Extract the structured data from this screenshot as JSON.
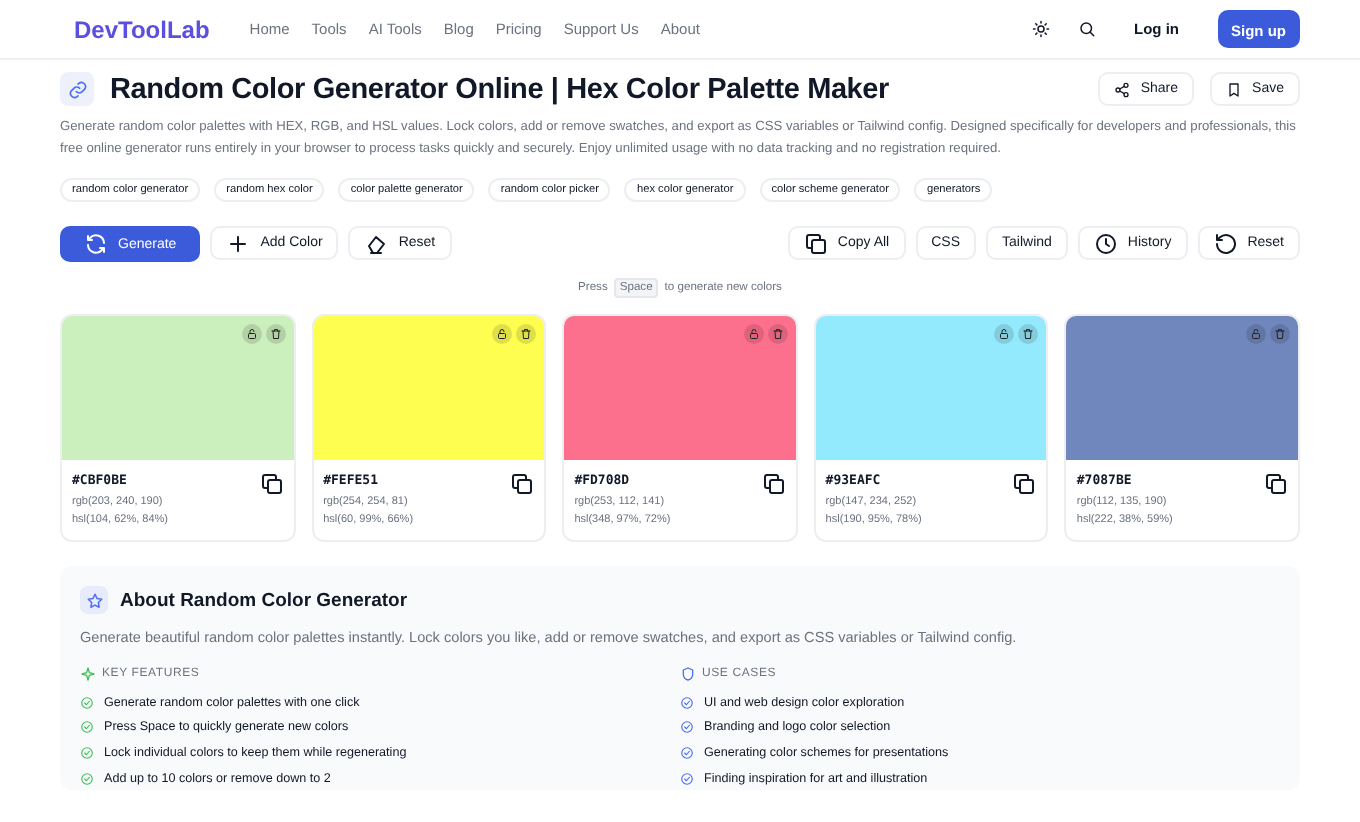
{
  "nav": {
    "logo": "DevToolLab",
    "links": [
      "Home",
      "Tools",
      "AI Tools",
      "Blog",
      "Pricing",
      "Support Us",
      "About"
    ],
    "login": "Log in",
    "signup": "Sign up"
  },
  "header": {
    "title": "Random Color Generator Online | Hex Color Palette Maker",
    "share": "Share",
    "save": "Save",
    "description": "Generate random color palettes with HEX, RGB, and HSL values. Lock colors, add or remove swatches, and export as CSS variables or Tailwind config. Designed specifically for developers and professionals, this free online generator runs entirely in your browser to process tasks quickly and securely. Enjoy unlimited usage with no data tracking and no registration required."
  },
  "tags": [
    "random color generator",
    "random hex color",
    "color palette generator",
    "random color picker",
    "hex color generator",
    "color scheme generator",
    "generators"
  ],
  "toolbar": {
    "left": [
      {
        "kind": "primary",
        "label": "Generate"
      },
      {
        "kind": "add",
        "label": "Add Color"
      },
      {
        "kind": "eraser",
        "label": "Reset"
      }
    ],
    "right": [
      {
        "kind": "copy",
        "label": "Copy All"
      },
      {
        "kind": "plain",
        "label": "CSS"
      },
      {
        "kind": "plain",
        "label": "Tailwind"
      },
      {
        "kind": "history",
        "label": "History"
      },
      {
        "kind": "reset",
        "label": "Reset"
      }
    ]
  },
  "hint": {
    "before": "Press",
    "key": "Space",
    "after": "to generate new colors"
  },
  "swatches": [
    {
      "color": "#cbf0be",
      "hex": "#CBF0BE",
      "rgb": "rgb(203, 240, 190)",
      "hsl": "hsl(104, 62%, 84%)"
    },
    {
      "color": "#fefe51",
      "hex": "#FEFE51",
      "rgb": "rgb(254, 254, 81)",
      "hsl": "hsl(60, 99%, 66%)"
    },
    {
      "color": "#fd708d",
      "hex": "#FD708D",
      "rgb": "rgb(253, 112, 141)",
      "hsl": "hsl(348, 97%, 72%)"
    },
    {
      "color": "#93eafc",
      "hex": "#93EAFC",
      "rgb": "rgb(147, 234, 252)",
      "hsl": "hsl(190, 95%, 78%)"
    },
    {
      "color": "#7087be",
      "hex": "#7087BE",
      "rgb": "rgb(112, 135, 190)",
      "hsl": "hsl(222, 38%, 59%)"
    }
  ],
  "about": {
    "title": "About Random Color Generator",
    "intro": "Generate beautiful random color palettes instantly. Lock colors you like, add or remove swatches, and export as CSS variables or Tailwind config.",
    "columns": [
      {
        "kind": "features",
        "heading": "KEY FEATURES",
        "items": [
          "Generate random color palettes with one click",
          "Press Space to quickly generate new colors",
          "Lock individual colors to keep them while regenerating",
          "Add up to 10 colors or remove down to 2"
        ]
      },
      {
        "kind": "uses",
        "heading": "USE CASES",
        "items": [
          "UI and web design color exploration",
          "Branding and logo color selection",
          "Generating color schemes for presentations",
          "Finding inspiration for art and illustration"
        ]
      }
    ]
  }
}
